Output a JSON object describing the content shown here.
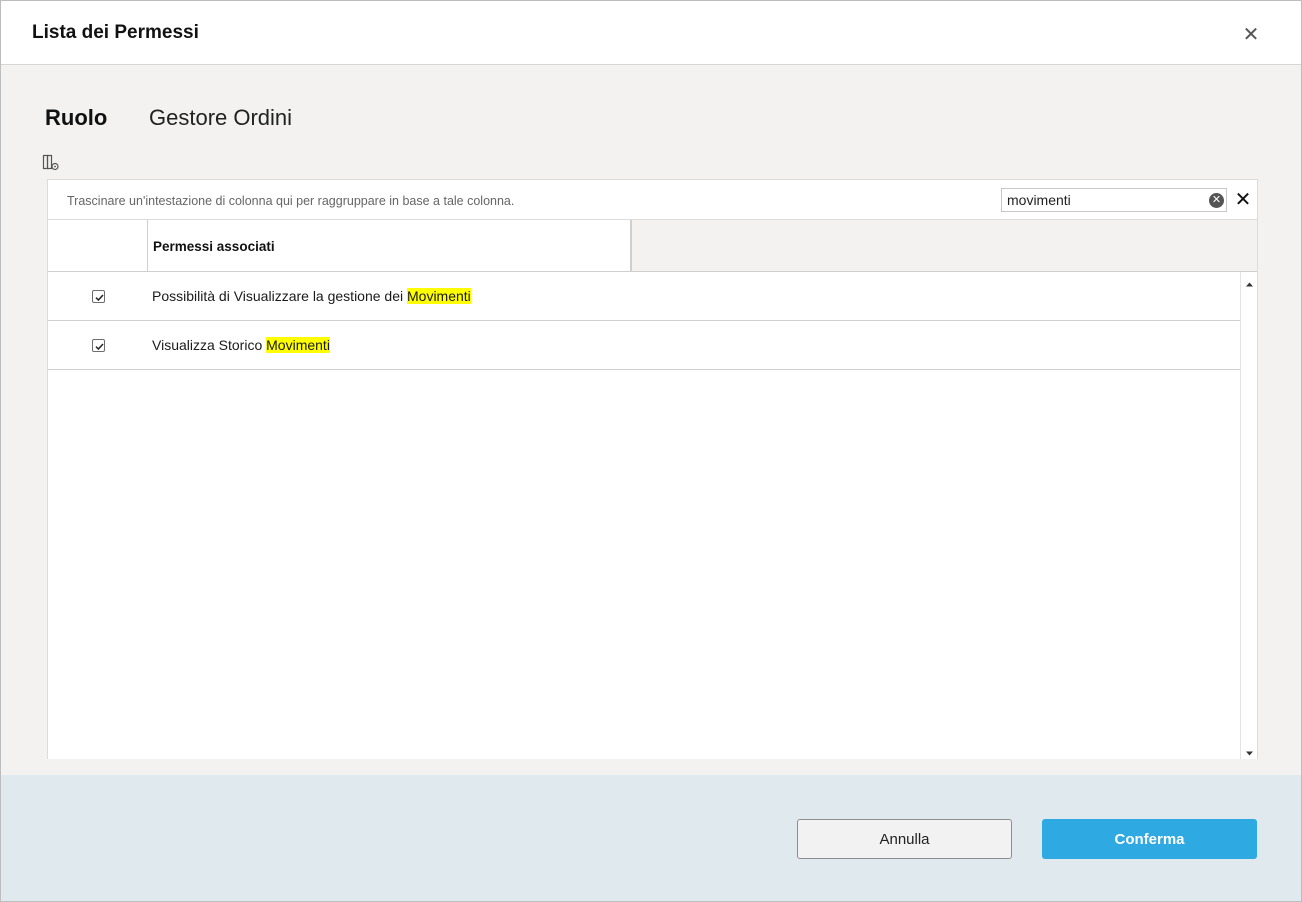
{
  "dialog": {
    "title": "Lista dei Permessi",
    "close_icon": "close-icon"
  },
  "role": {
    "label": "Ruolo",
    "value": "Gestore Ordini"
  },
  "toolbar": {
    "column_chooser_icon": "column-chooser-icon"
  },
  "grid": {
    "group_hint": "Trascinare un'intestazione di colonna qui per raggruppare in base a tale colonna.",
    "search": {
      "value": "movimenti",
      "clear_icon": "clear-circle-icon",
      "close_icon": "close-icon"
    },
    "columns": [
      {
        "label": "Permessi associati"
      }
    ],
    "rows": [
      {
        "checked": true,
        "text_before": "Possibilità di Visualizzare la gestione dei ",
        "highlight": "Movimenti"
      },
      {
        "checked": true,
        "text_before": "Visualizza Storico ",
        "highlight": "Movimenti"
      }
    ],
    "highlight_color": "#ffff00"
  },
  "footer": {
    "cancel_label": "Annulla",
    "confirm_label": "Conferma",
    "confirm_color": "#2fa9e2"
  }
}
